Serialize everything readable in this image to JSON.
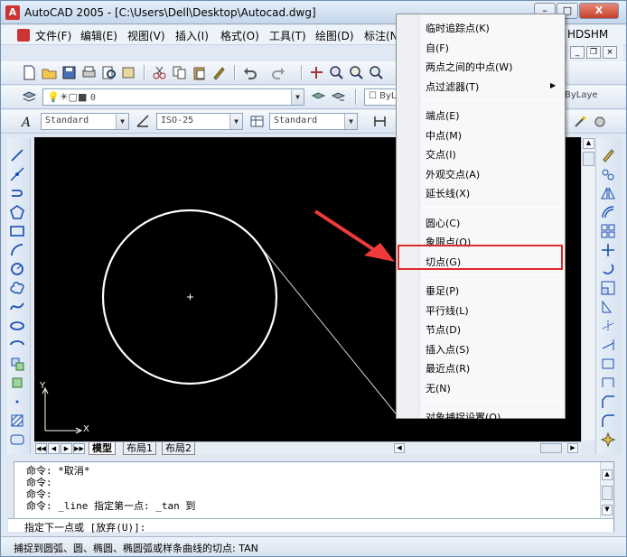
{
  "window": {
    "title": "AutoCAD 2005 - [C:\\Users\\Dell\\Desktop\\Autocad.dwg]",
    "minimize_label": "–",
    "restore_label": "□",
    "close_label": "X"
  },
  "menubar": {
    "items": [
      "文件(F)",
      "编辑(E)",
      "视图(V)",
      "插入(I)",
      "格式(O)",
      "工具(T)",
      "绘图(D)",
      "标注(N"
    ],
    "right_fragment": "HDSHM"
  },
  "toolbar_layers": {
    "layer_value": "0",
    "bylayer_fragment": "ByL",
    "bylayer_right": "ByLayer"
  },
  "toolbar_styles": {
    "text_style": "Standard",
    "dim_style": "ISO-25",
    "table_style": "Standard"
  },
  "canvas": {
    "ucs_y": "Y",
    "ucs_x": "X"
  },
  "layout_tabs": [
    "模型",
    "布局1",
    "布局2"
  ],
  "command_history": [
    "命令: *取消*",
    "命令:",
    "命令:",
    "命令: _line 指定第一点: _tan 到"
  ],
  "command_prompt": "指定下一点或 [放弃(U)]:",
  "status_bar": {
    "text": "捕捉到圆弧、圆、椭圆、椭圆弧或样条曲线的切点:  TAN"
  },
  "context_menu": {
    "groups": [
      [
        {
          "label": "临时追踪点(K)"
        },
        {
          "label": "自(F)"
        },
        {
          "label": "两点之间的中点(W)"
        },
        {
          "label": "点过滤器(T)",
          "submenu": true
        }
      ],
      [
        {
          "label": "端点(E)"
        },
        {
          "label": "中点(M)"
        },
        {
          "label": "交点(I)"
        },
        {
          "label": "外观交点(A)"
        },
        {
          "label": "延长线(X)"
        }
      ],
      [
        {
          "label": "圆心(C)"
        },
        {
          "label": "象限点(Q)"
        },
        {
          "label": "切点(G)",
          "highlighted": true
        }
      ],
      [
        {
          "label": "垂足(P)"
        },
        {
          "label": "平行线(L)"
        },
        {
          "label": "节点(D)"
        },
        {
          "label": "插入点(S)"
        },
        {
          "label": "最近点(R)"
        },
        {
          "label": "无(N)"
        }
      ],
      [
        {
          "label": "对象捕捉设置(O)..."
        }
      ]
    ],
    "submenu_arrow": "▶"
  },
  "colors": {
    "canvas_bg": "#000000",
    "highlight_border": "#e02a2a",
    "annotation_arrow": "#ee3a3a"
  }
}
